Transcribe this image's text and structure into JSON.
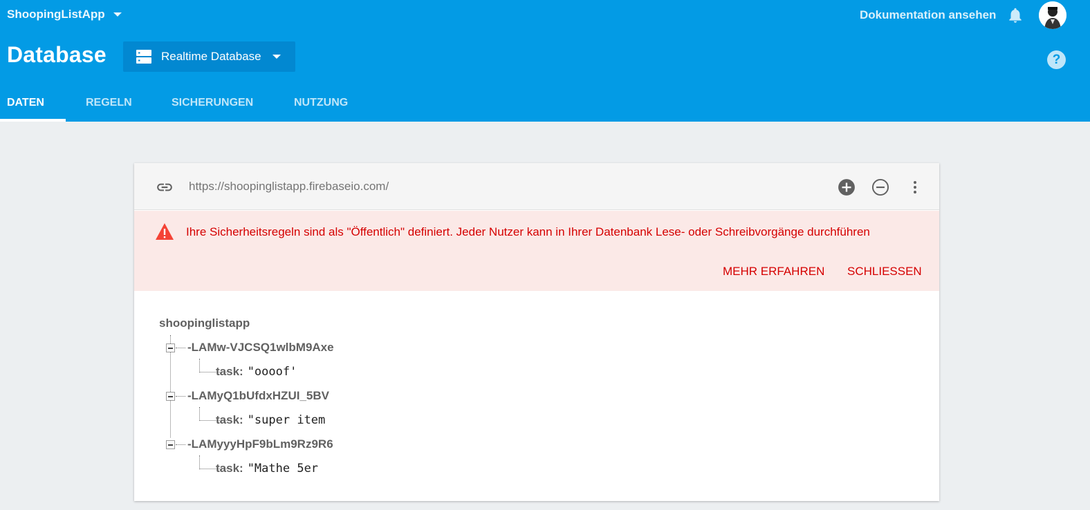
{
  "header": {
    "project_name": "ShoopingListApp",
    "doc_link": "Dokumentation ansehen",
    "title": "Database",
    "db_selector": "Realtime Database",
    "help": "?"
  },
  "tabs": [
    {
      "label": "DATEN",
      "active": true
    },
    {
      "label": "REGELN",
      "active": false
    },
    {
      "label": "SICHERUNGEN",
      "active": false
    },
    {
      "label": "NUTZUNG",
      "active": false
    }
  ],
  "urlbar": {
    "url": "https://shoopinglistapp.firebaseio.com/"
  },
  "alert": {
    "message": "Ihre Sicherheitsregeln sind als \"Öffentlich\" definiert. Jeder Nutzer kann in Ihrer Datenbank Lese- oder Schreibvorgänge durchführen",
    "learn_more": "MEHR ERFAHREN",
    "close": "SCHLIESSEN"
  },
  "tree": {
    "root": "shoopinglistapp",
    "nodes": [
      {
        "key": "-LAMw-VJCSQ1wlbM9Axe",
        "child_key": "task:",
        "child_value": "\"oooof'"
      },
      {
        "key": "-LAMyQ1bUfdxHZUI_5BV",
        "child_key": "task:",
        "child_value": "\"super item"
      },
      {
        "key": "-LAMyyyHpF9bLm9Rz9R6",
        "child_key": "task:",
        "child_value": "\"Mathe 5er"
      }
    ]
  },
  "colors": {
    "header_bg": "#039be5",
    "selector_bg": "#0288d1",
    "alert_bg": "#fbe9e7",
    "alert_text": "#d50000",
    "page_bg": "#eceff1"
  },
  "icons": [
    "chevron-down-icon",
    "bell-icon",
    "avatar",
    "database-icon",
    "help-icon",
    "link-icon",
    "add-circle-icon",
    "remove-circle-icon",
    "more-vert-icon",
    "warning-icon",
    "collapse-icon"
  ]
}
